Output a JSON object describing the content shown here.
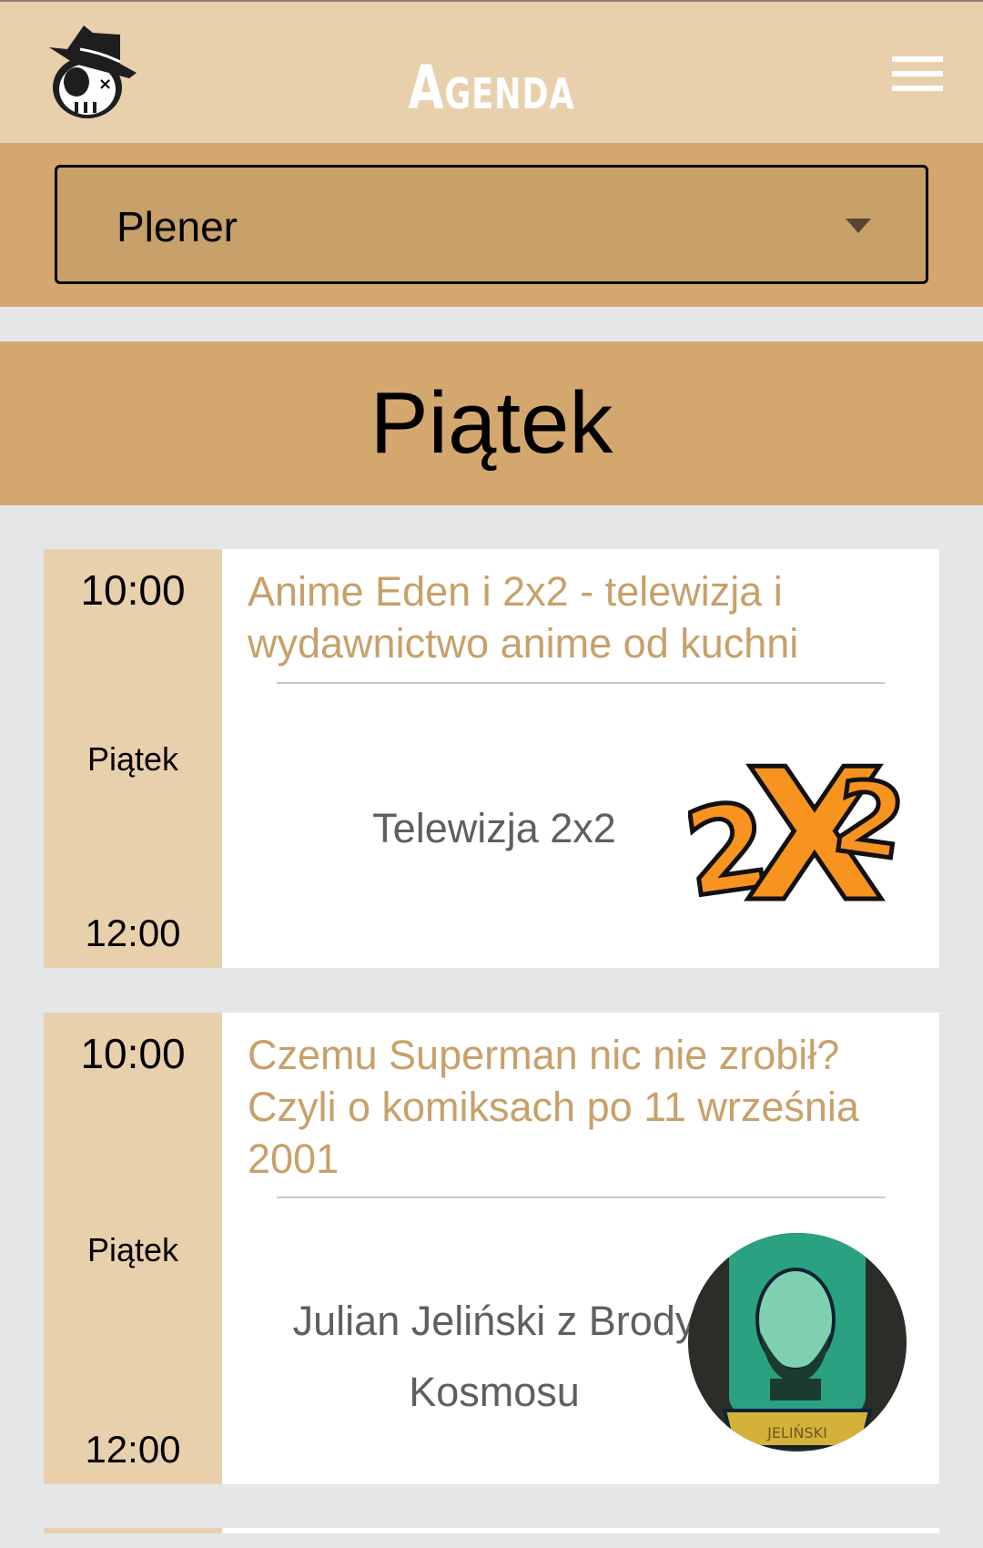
{
  "header": {
    "title": "Agenda",
    "logo": "skull-fedora-logo",
    "menu_icon": "hamburger-icon"
  },
  "filter": {
    "selected": "Plener"
  },
  "day": "Piątek",
  "events": [
    {
      "start": "10:00",
      "day": "Piątek",
      "end": "12:00",
      "title": "Anime Eden i 2x2 - telewizja i wydawnictwo anime od kuchni",
      "speaker": "Telewizja 2x2",
      "image": "2x2-logo"
    },
    {
      "start": "10:00",
      "day": "Piątek",
      "end": "12:00",
      "title": "Czemu Superman nic nie zrobił? Czyli o komiksach po 11 września 2001",
      "speaker": "Julian Jeliński z Brody Kosmosu",
      "image": "speaker-avatar",
      "image_caption": "JELIŃSKI"
    }
  ],
  "colors": {
    "header_bg": "#e9d0ad",
    "band_bg": "#d4a76f",
    "select_bg": "#c8a06a",
    "title_color": "#c8a06a"
  }
}
